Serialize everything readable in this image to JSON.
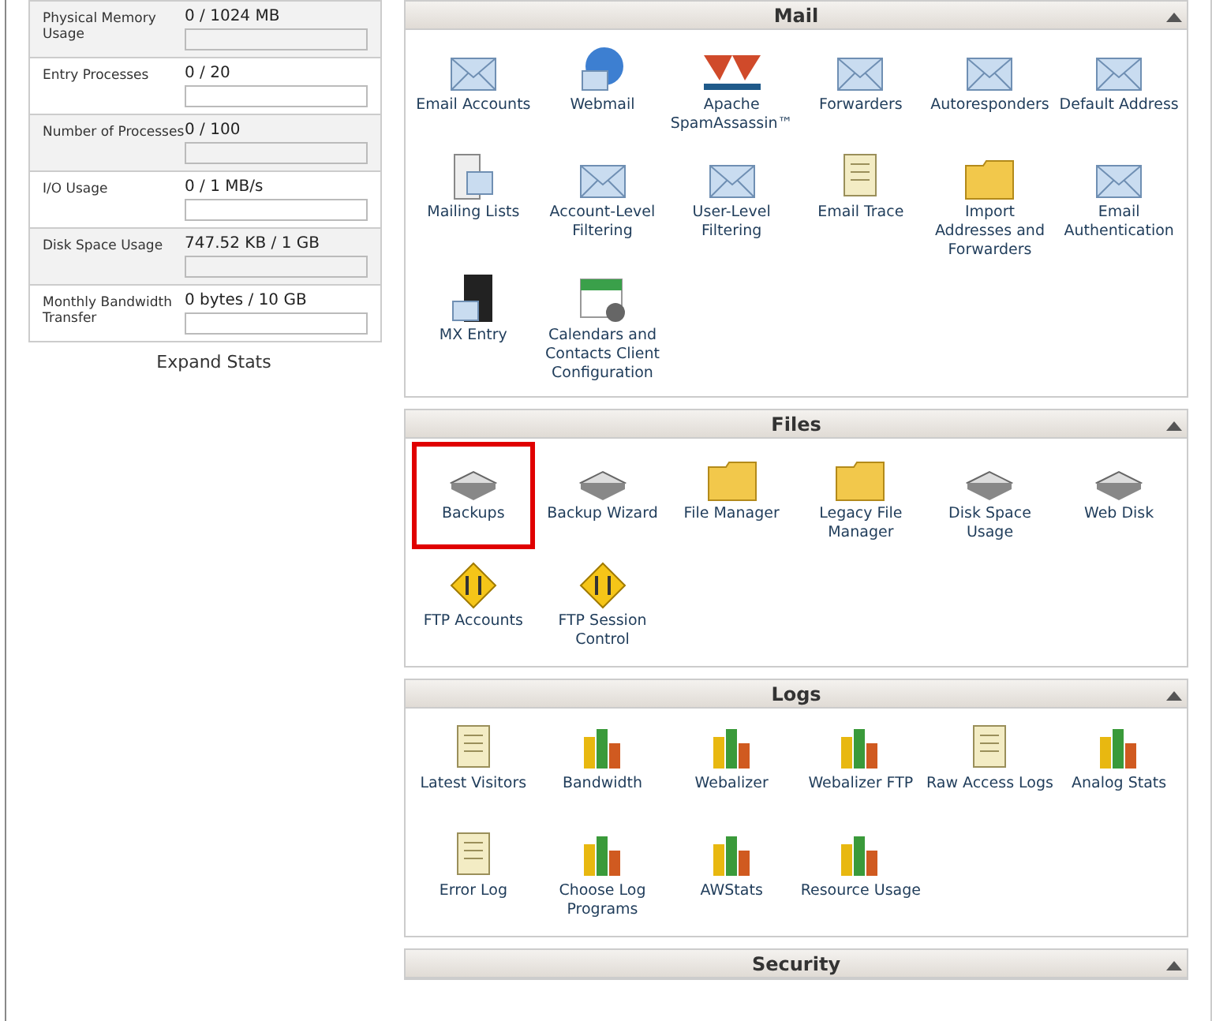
{
  "stats": [
    {
      "label": "Physical Memory Usage",
      "value": "0 / 1024 MB"
    },
    {
      "label": "Entry Processes",
      "value": "0 / 20"
    },
    {
      "label": "Number of Processes",
      "value": "0 / 100"
    },
    {
      "label": "I/O Usage",
      "value": "0 / 1 MB/s"
    },
    {
      "label": "Disk Space Usage",
      "value": "747.52 KB / 1 GB"
    },
    {
      "label": "Monthly Bandwidth Transfer",
      "value": "0 bytes / 10 GB"
    }
  ],
  "expand_stats": "Expand Stats",
  "sections": [
    {
      "title": "Mail",
      "expanded": true,
      "items": [
        {
          "label": "Email Accounts",
          "highlighted": false
        },
        {
          "label": "Webmail",
          "highlighted": false
        },
        {
          "label": "Apache SpamAssassin™",
          "highlighted": false
        },
        {
          "label": "Forwarders",
          "highlighted": false
        },
        {
          "label": "Autoresponders",
          "highlighted": false
        },
        {
          "label": "Default Address",
          "highlighted": false
        },
        {
          "label": "Mailing Lists",
          "highlighted": false
        },
        {
          "label": "Account-Level Filtering",
          "highlighted": false
        },
        {
          "label": "User-Level Filtering",
          "highlighted": false
        },
        {
          "label": "Email Trace",
          "highlighted": false
        },
        {
          "label": "Import Addresses and Forwarders",
          "highlighted": false
        },
        {
          "label": "Email Authentication",
          "highlighted": false
        },
        {
          "label": "MX Entry",
          "highlighted": false
        },
        {
          "label": "Calendars and Contacts Client Configuration",
          "highlighted": false
        }
      ]
    },
    {
      "title": "Files",
      "expanded": true,
      "items": [
        {
          "label": "Backups",
          "highlighted": true
        },
        {
          "label": "Backup Wizard",
          "highlighted": false
        },
        {
          "label": "File Manager",
          "highlighted": false
        },
        {
          "label": "Legacy File Manager",
          "highlighted": false
        },
        {
          "label": "Disk Space Usage",
          "highlighted": false
        },
        {
          "label": "Web Disk",
          "highlighted": false
        },
        {
          "label": "FTP Accounts",
          "highlighted": false
        },
        {
          "label": "FTP Session Control",
          "highlighted": false
        }
      ]
    },
    {
      "title": "Logs",
      "expanded": true,
      "items": [
        {
          "label": "Latest Visitors",
          "highlighted": false
        },
        {
          "label": "Bandwidth",
          "highlighted": false
        },
        {
          "label": "Webalizer",
          "highlighted": false
        },
        {
          "label": "Webalizer FTP",
          "highlighted": false
        },
        {
          "label": "Raw Access Logs",
          "highlighted": false
        },
        {
          "label": "Analog Stats",
          "highlighted": false
        },
        {
          "label": "Error Log",
          "highlighted": false
        },
        {
          "label": "Choose Log Programs",
          "highlighted": false
        },
        {
          "label": "AWStats",
          "highlighted": false
        },
        {
          "label": "Resource Usage",
          "highlighted": false
        }
      ]
    },
    {
      "title": "Security",
      "expanded": true
    }
  ]
}
